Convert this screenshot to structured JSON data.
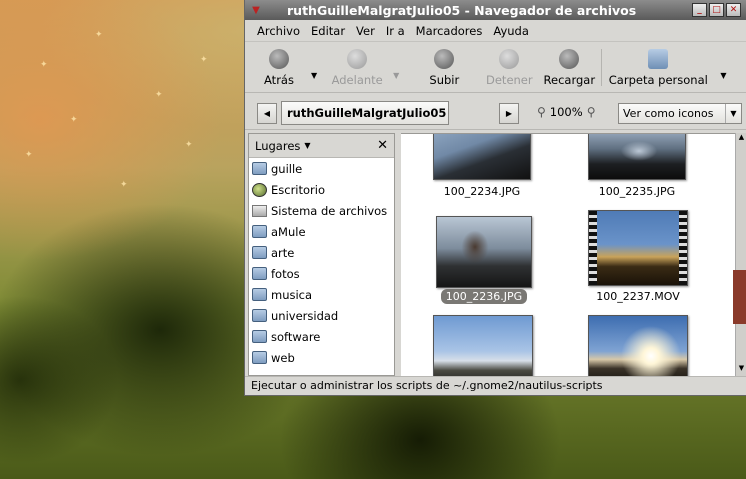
{
  "window": {
    "title": "ruthGuilleMalgratJulio05 - Navegador de archivos",
    "controls": [
      "minimize",
      "maximize",
      "close"
    ]
  },
  "menubar": [
    "Archivo",
    "Editar",
    "Ver",
    "Ir a",
    "Marcadores",
    "Ayuda"
  ],
  "toolbar": {
    "back": "Atrás",
    "forward": "Adelante",
    "up": "Subir",
    "stop": "Detener",
    "reload": "Recargar",
    "home": "Carpeta personal"
  },
  "location": {
    "crumb": "ruthGuilleMalgratJulio05",
    "zoom": "100%",
    "view_mode": "Ver como iconos"
  },
  "sidebar": {
    "header": "Lugares",
    "items": [
      {
        "label": "guille",
        "icon": "folder-icon"
      },
      {
        "label": "Escritorio",
        "icon": "desktop-icon"
      },
      {
        "label": "Sistema de archivos",
        "icon": "filesystem-icon"
      },
      {
        "label": "aMule",
        "icon": "folder-icon"
      },
      {
        "label": "arte",
        "icon": "folder-icon"
      },
      {
        "label": "fotos",
        "icon": "folder-icon"
      },
      {
        "label": "musica",
        "icon": "folder-icon"
      },
      {
        "label": "universidad",
        "icon": "folder-icon"
      },
      {
        "label": "software",
        "icon": "folder-icon"
      },
      {
        "label": "web",
        "icon": "folder-icon"
      }
    ]
  },
  "files": [
    {
      "name": "100_2234.JPG",
      "selected": false
    },
    {
      "name": "100_2235.JPG",
      "selected": false
    },
    {
      "name": "100_2236.JPG",
      "selected": true
    },
    {
      "name": "100_2237.MOV",
      "selected": false
    },
    {
      "name": "",
      "selected": false
    },
    {
      "name": "",
      "selected": false
    }
  ],
  "status": "Ejecutar o administrar los scripts de ~/.gnome2/nautilus-scripts"
}
